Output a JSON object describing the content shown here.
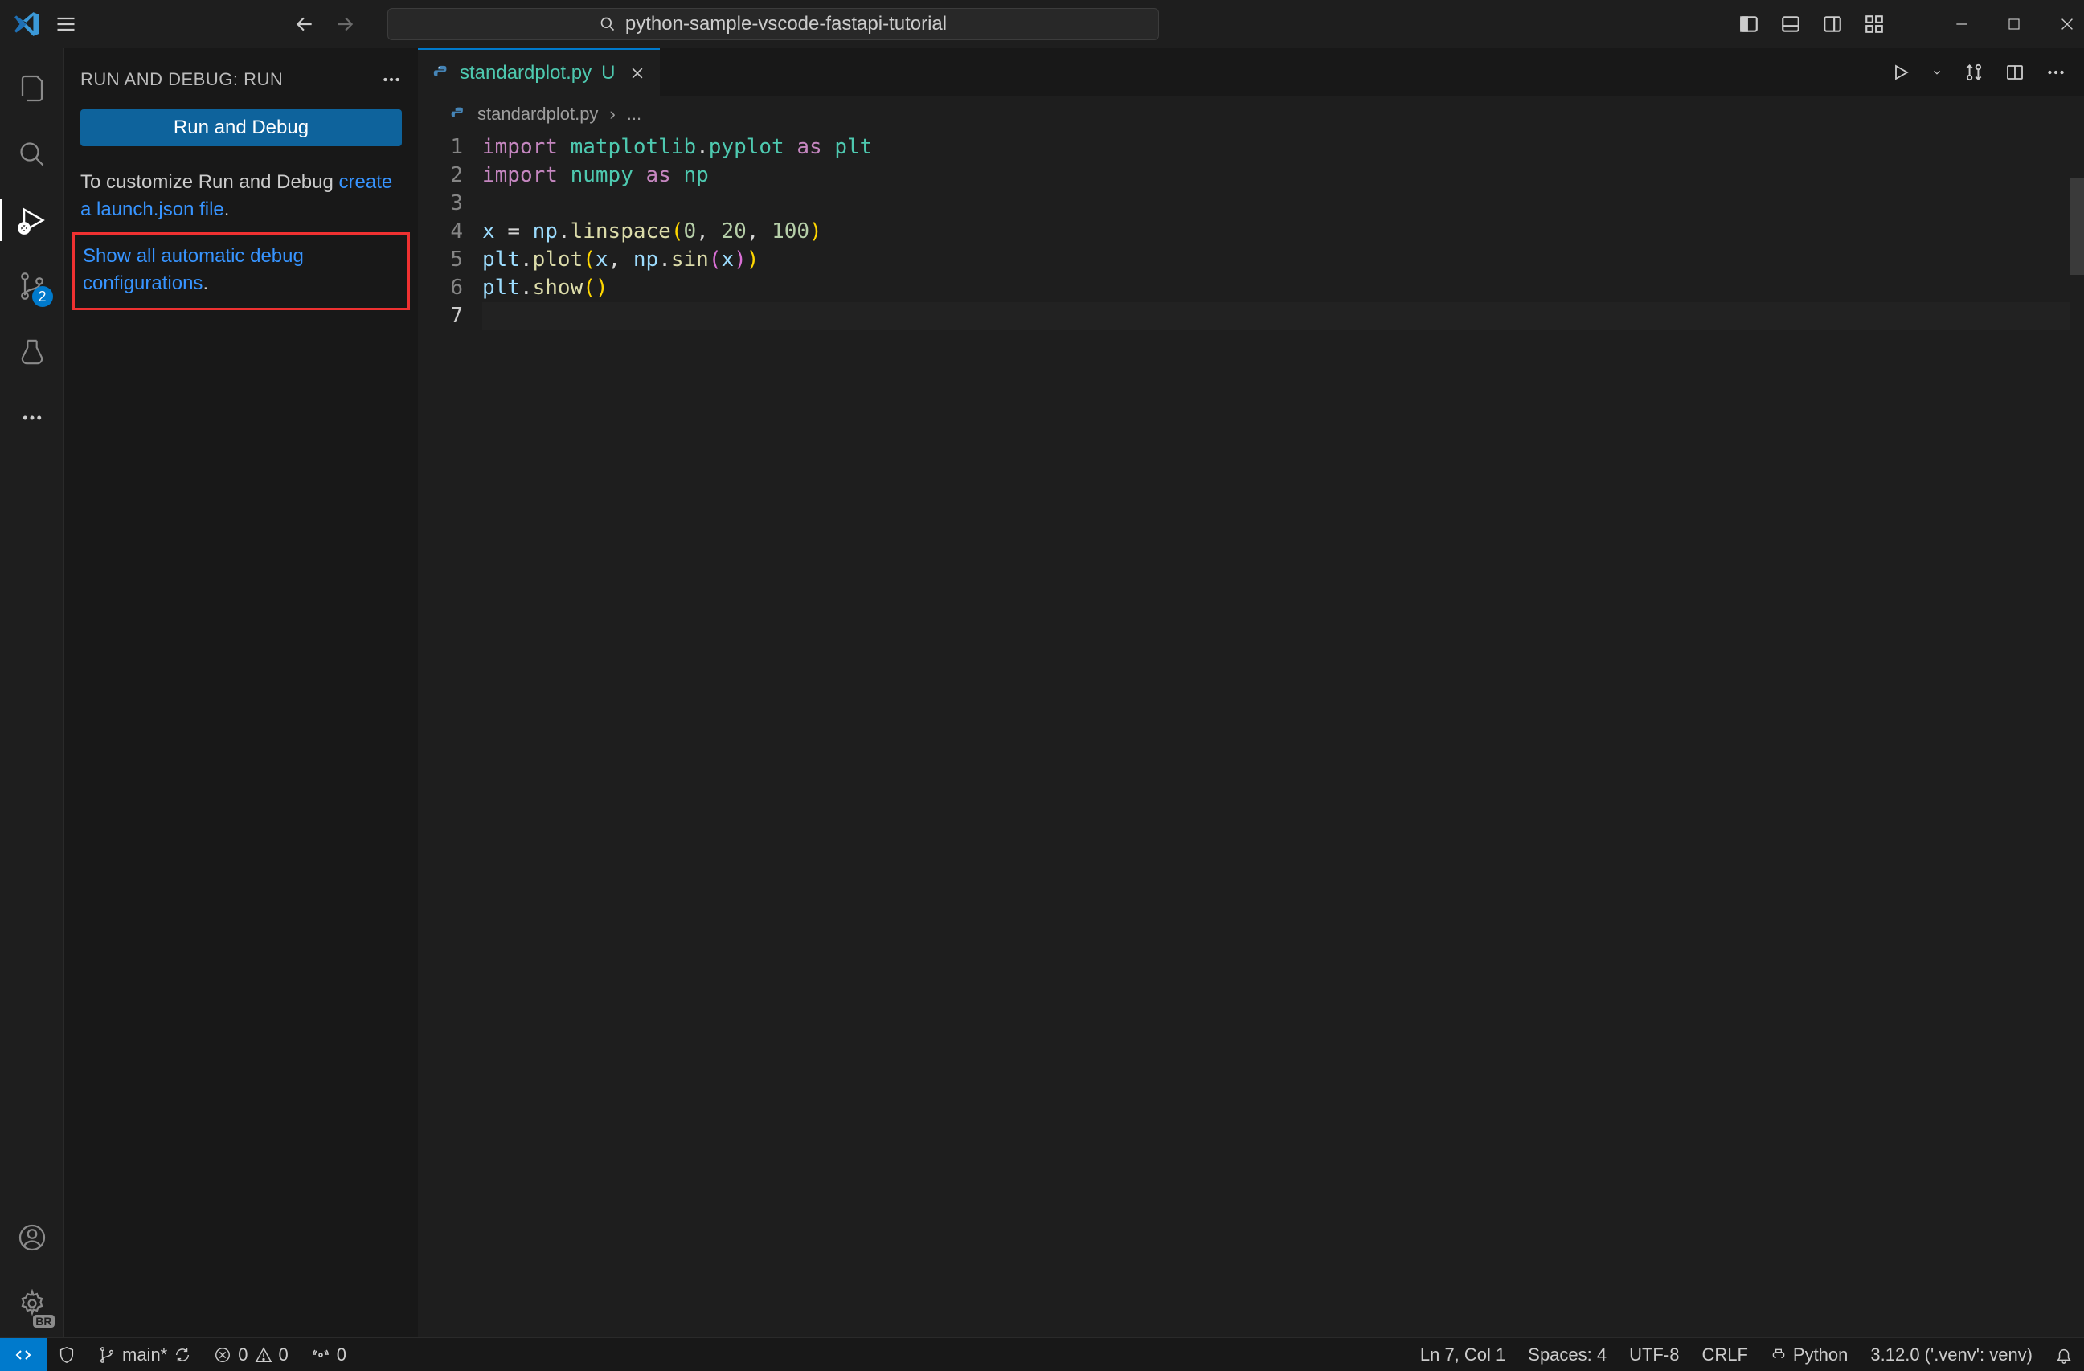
{
  "titlebar": {
    "search_text": "python-sample-vscode-fastapi-tutorial"
  },
  "activitybar": {
    "scm_badge": "2",
    "settings_badge": "BR"
  },
  "sidebar": {
    "title": "RUN AND DEBUG: RUN",
    "run_button": "Run and Debug",
    "customize_text": "To customize Run and Debug ",
    "create_link": "create a launch.json file",
    "customize_suffix": ".",
    "show_all_link": "Show all automatic debug configurations",
    "show_all_suffix": "."
  },
  "tab": {
    "filename": "standardplot.py",
    "modified_marker": "U"
  },
  "breadcrumb": {
    "file": "standardplot.py",
    "sep": "›",
    "more": "..."
  },
  "code": {
    "line_numbers": [
      "1",
      "2",
      "3",
      "4",
      "5",
      "6",
      "7"
    ]
  },
  "statusbar": {
    "branch": "main*",
    "errors": "0",
    "warnings": "0",
    "ports": "0",
    "cursor": "Ln 7, Col 1",
    "spaces": "Spaces: 4",
    "encoding": "UTF-8",
    "eol": "CRLF",
    "lang": "Python",
    "interp": "3.12.0 ('.venv': venv)"
  }
}
